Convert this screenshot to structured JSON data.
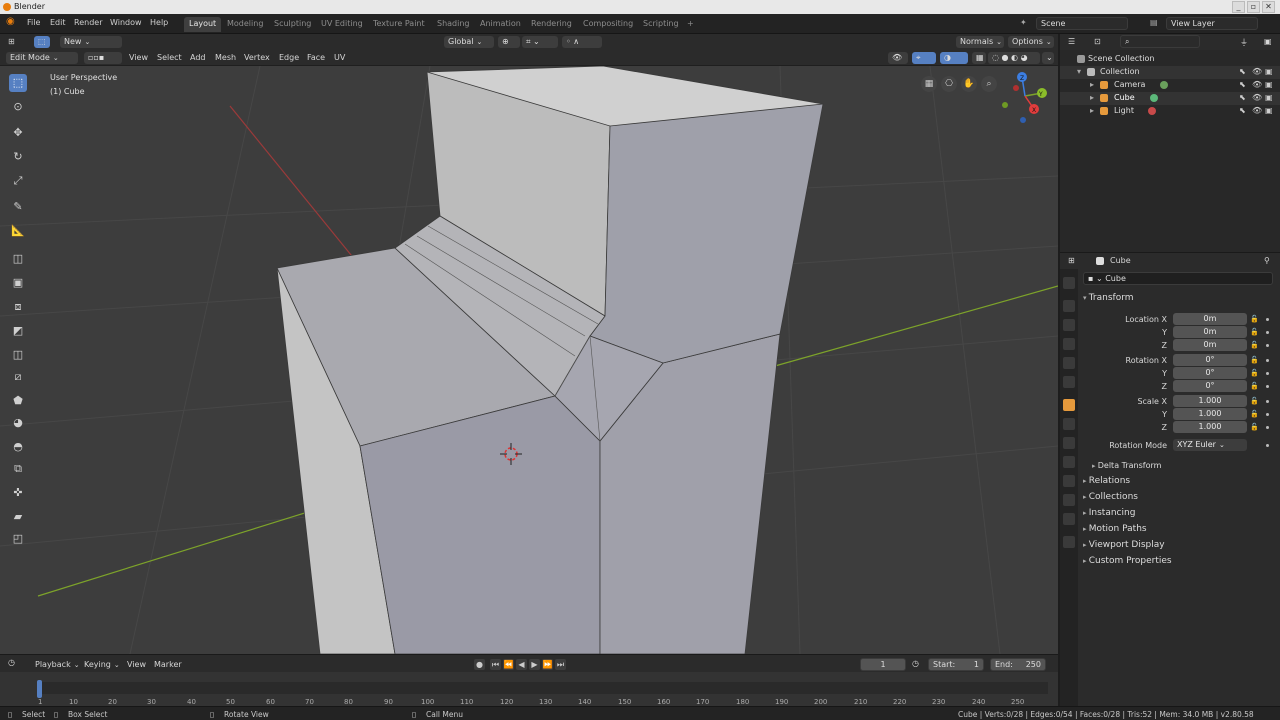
{
  "title": "Blender",
  "menu": [
    "File",
    "Edit",
    "Render",
    "Window",
    "Help"
  ],
  "workspaces": [
    "Layout",
    "Modeling",
    "Sculpting",
    "UV Editing",
    "Texture Paint",
    "Shading",
    "Animation",
    "Rendering",
    "Compositing",
    "Scripting"
  ],
  "add_tab": "+",
  "scene": "Scene",
  "view_layer": "View Layer",
  "header1": {
    "new_label": "New",
    "orientation": "Global",
    "normals": "Normals",
    "options": "Options"
  },
  "header2": {
    "mode": "Edit Mode",
    "menus": [
      "View",
      "Select",
      "Add",
      "Mesh",
      "Vertex",
      "Edge",
      "Face",
      "UV"
    ]
  },
  "viewport": {
    "perspective": "User Perspective",
    "object": "(1) Cube",
    "gizmo": {
      "x": "X",
      "y": "Y",
      "z": "Z"
    }
  },
  "outliner": {
    "root": "Scene Collection",
    "collection": "Collection",
    "items": [
      "Camera",
      "Cube",
      "Light"
    ]
  },
  "properties": {
    "header_object": "Cube",
    "name_field": "Cube",
    "transform_title": "Transform",
    "location_label": "Location X",
    "rotation_label": "Rotation X",
    "scale_label": "Scale X",
    "y_label": "Y",
    "z_label": "Z",
    "location": [
      "0m",
      "0m",
      "0m"
    ],
    "rotation": [
      "0°",
      "0°",
      "0°"
    ],
    "scale": [
      "1.000",
      "1.000",
      "1.000"
    ],
    "rotation_mode_label": "Rotation Mode",
    "rotation_mode": "XYZ Euler",
    "delta_transform": "Delta Transform",
    "panels": [
      "Relations",
      "Collections",
      "Instancing",
      "Motion Paths",
      "Viewport Display",
      "Custom Properties"
    ]
  },
  "timeline": {
    "menus": [
      "Playback",
      "Keying",
      "View",
      "Marker"
    ],
    "current_frame": "1",
    "start_label": "Start:",
    "start": "1",
    "end_label": "End:",
    "end": "250",
    "ticks": [
      "1",
      "10",
      "20",
      "30",
      "40",
      "50",
      "60",
      "70",
      "80",
      "90",
      "100",
      "110",
      "120",
      "130",
      "140",
      "150",
      "160",
      "170",
      "180",
      "190",
      "200",
      "210",
      "220",
      "230",
      "240",
      "250"
    ]
  },
  "statusbar": {
    "select": "Select",
    "box_select": "Box Select",
    "rotate_view": "Rotate View",
    "call_menu": "Call Menu",
    "stats": "Cube | Verts:0/28 | Edges:0/54 | Faces:0/28 | Tris:52 | Mem: 34.0 MB | v2.80.58"
  },
  "colors": {
    "accent": "#5680c2",
    "x_axis": "#e23c3c",
    "y_axis": "#8bbd2a",
    "z_axis": "#3c7ee2"
  }
}
